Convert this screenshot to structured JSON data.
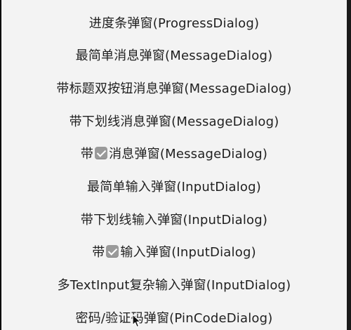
{
  "menu": {
    "items": [
      {
        "label": "进度条弹窗(ProgressDialog)"
      },
      {
        "label": "最简单消息弹窗(MessageDialog)"
      },
      {
        "label": "带标题双按钮消息弹窗(MessageDialog)"
      },
      {
        "label": "带下划线消息弹窗(MessageDialog)"
      },
      {
        "label_before": "带",
        "icon": "check-mark-button-icon",
        "label_after": "消息弹窗(MessageDialog)"
      },
      {
        "label": "最简单输入弹窗(InputDialog)"
      },
      {
        "label": "带下划线输入弹窗(InputDialog)"
      },
      {
        "label_before": "带",
        "icon": "check-mark-button-icon",
        "label_after": "输入弹窗(InputDialog)"
      },
      {
        "label": "多TextInput复杂输入弹窗(InputDialog)"
      },
      {
        "label": "密码/验证码弹窗(PinCodeDialog)"
      }
    ]
  },
  "colors": {
    "background": "#f3f3f3",
    "text": "#1f1f1f",
    "frame": "#000000"
  }
}
